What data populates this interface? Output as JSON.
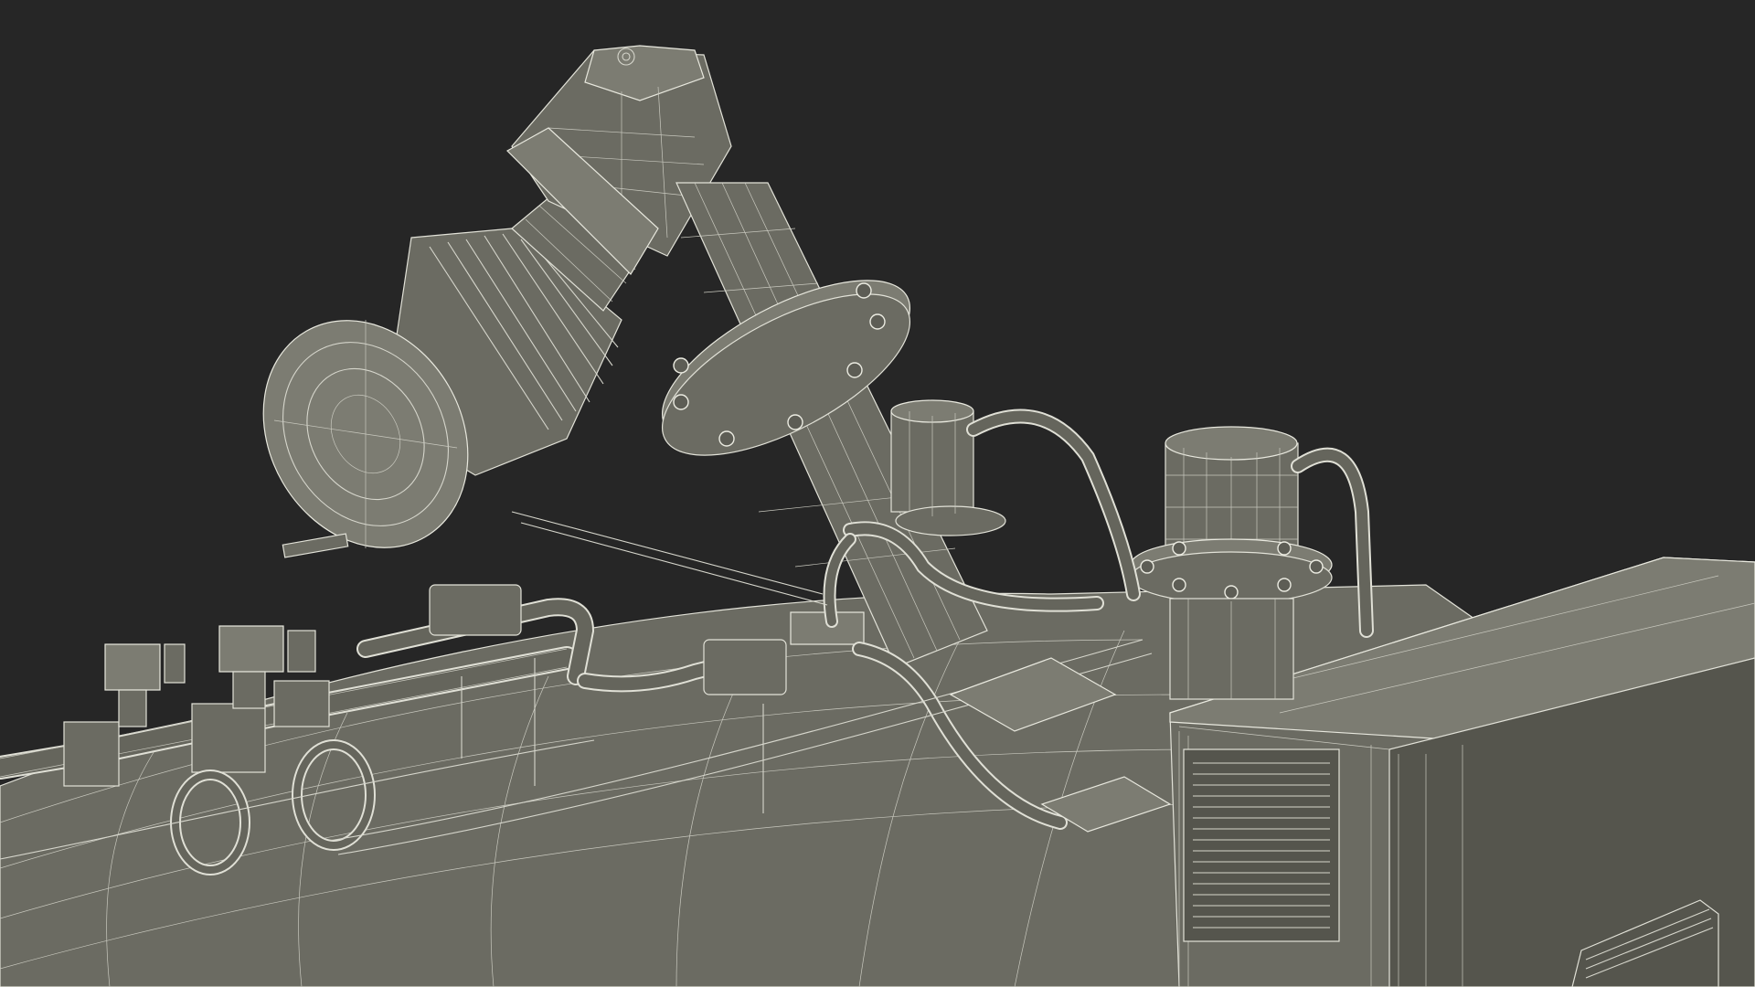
{
  "scene": {
    "background_color": "#262626",
    "model_fill_color": "#6b6b62",
    "wire_color": "#d6d6cc"
  }
}
